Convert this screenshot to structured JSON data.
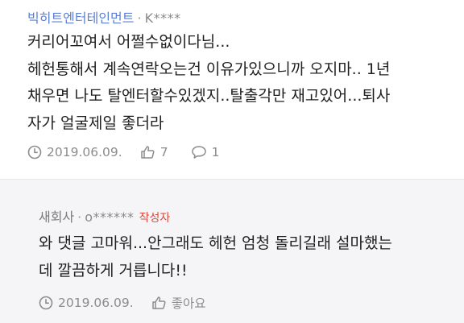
{
  "comments": [
    {
      "company": "빅히트엔터테인먼트",
      "separator": "·",
      "author": "K****",
      "lines": [
        "커리어꼬여서 어쩔수없이다님...",
        "헤헌통해서 계속연락오는건 이유가있으니까 오지마.. 1년",
        "채우면 나도 탈엔터할수있겠지..탈출각만 재고있어...퇴사",
        "자가 얼굴제일 좋더라"
      ],
      "date": "2019.06.09.",
      "likes": "7",
      "replies": "1",
      "icons": [
        "clock-icon",
        "thumbs-up-icon",
        "speech-bubble-icon"
      ]
    },
    {
      "company": "새회사",
      "separator": "·",
      "author": "o******",
      "badge": "작성자",
      "lines": [
        "와 댓글 고마워...안그래도 헤헌 엄청 돌리길래 설마했는",
        "데 깔끔하게 거릅니다!!"
      ],
      "date": "2019.06.09.",
      "like_label": "좋아요",
      "icons": [
        "clock-icon",
        "thumbs-up-icon"
      ]
    }
  ],
  "colors": {
    "company_link": "#5a7fd6",
    "author_badge": "#e0483b",
    "meta_gray": "#8c8c8c",
    "reply_background": "#f5f5f7"
  }
}
